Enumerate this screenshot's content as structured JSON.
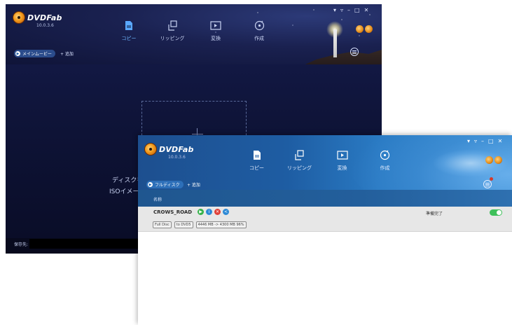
{
  "back_window": {
    "app_name": "DVDFab",
    "version": "10.0.3.6",
    "nav": [
      {
        "label": "コピー",
        "icon": "copy-icon"
      },
      {
        "label": "リッピング",
        "icon": "ripper-icon"
      },
      {
        "label": "変換",
        "icon": "converter-icon"
      },
      {
        "label": "作成",
        "icon": "creator-icon"
      }
    ],
    "mode_pill": "メインムービー",
    "add_label": "+ 追加",
    "hint_line1": "ディスクを",
    "hint_line2": "ISOイメージ",
    "save_label": "保存先:"
  },
  "front_window": {
    "app_name": "DVDFab",
    "version": "10.0.3.6",
    "nav": [
      {
        "label": "コピー",
        "icon": "copy-icon"
      },
      {
        "label": "リッピング",
        "icon": "ripper-icon"
      },
      {
        "label": "変換",
        "icon": "converter-icon"
      },
      {
        "label": "作成",
        "icon": "creator-icon"
      }
    ],
    "mode_pill": "フルディスク",
    "add_label": "+ 追加",
    "column_name": "名称",
    "item": {
      "title": "CROWS_ROAD",
      "tags": [
        "Full Disc",
        "to DVD5",
        "4446 MB -> 4300 MB 96%"
      ],
      "status": "準備完了"
    }
  },
  "colors": {
    "back_bg": "#0c0f2c",
    "front_header": "#1e5da3",
    "toggle_on": "#3ec05a",
    "accent": "#6fb6ff"
  }
}
